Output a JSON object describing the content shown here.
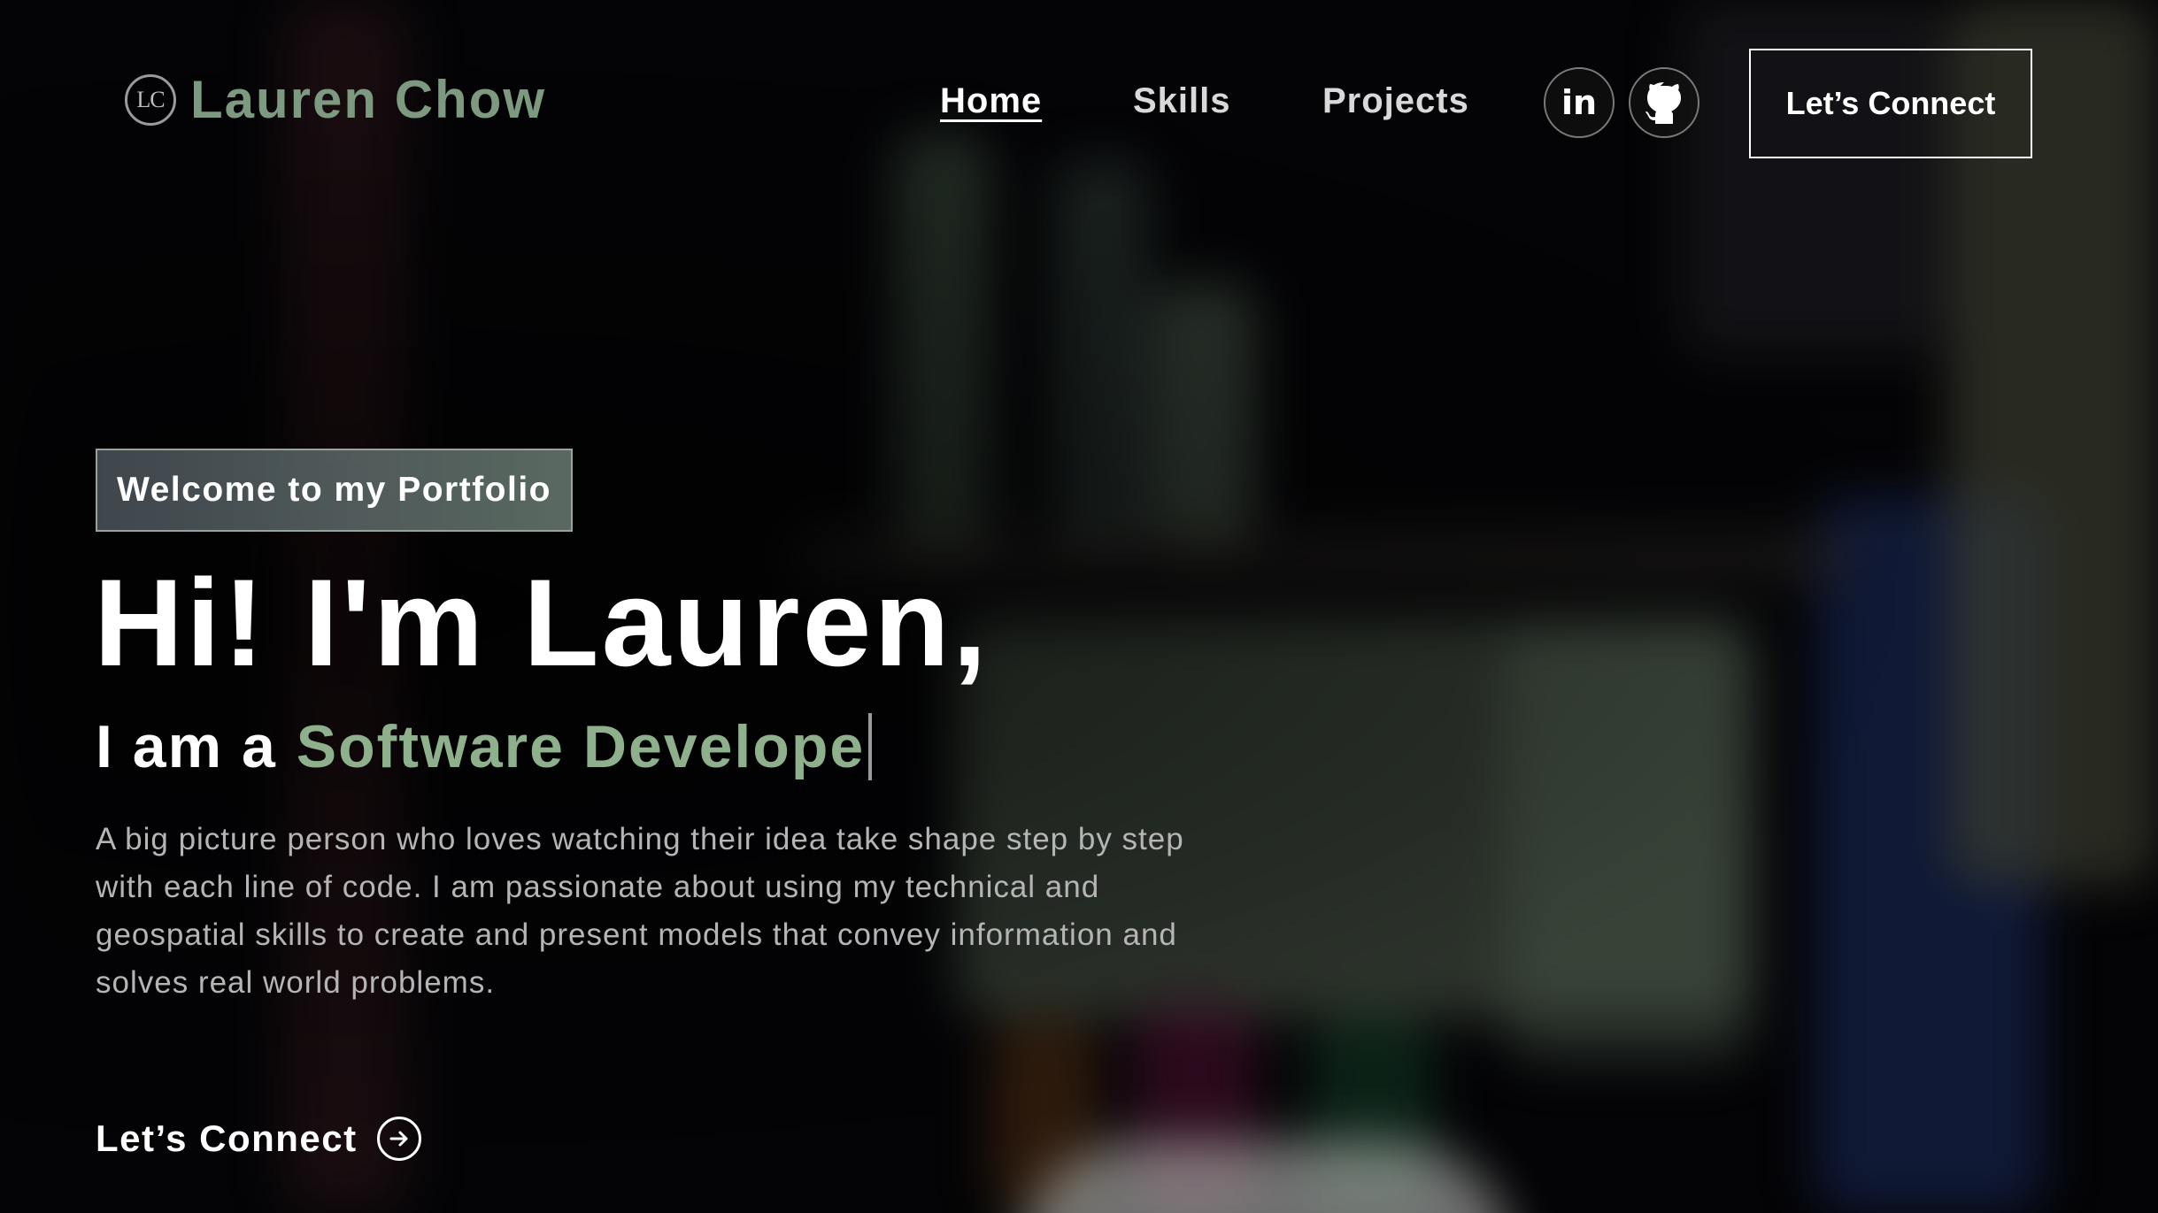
{
  "brand": {
    "monogram": "LC",
    "name": "Lauren Chow"
  },
  "nav": {
    "links": [
      {
        "label": "Home",
        "active": true
      },
      {
        "label": "Skills",
        "active": false
      },
      {
        "label": "Projects",
        "active": false
      }
    ],
    "social": [
      {
        "icon": "linkedin-icon",
        "text": "in"
      },
      {
        "icon": "github-icon"
      }
    ],
    "cta_label": "Let’s Connect"
  },
  "hero": {
    "tagline": "Welcome to my Portfolio",
    "headline": "Hi! I'm Lauren,",
    "subhead_prefix": "I am a",
    "role_typed": "Software Develope",
    "bio": "A big picture person who loves watching their idea take shape step by step with each line of code. I am passionate about using my technical and geospatial skills to create and present models that convey information and solves real world problems.",
    "cta_label": "Let’s Connect"
  },
  "colors": {
    "accent_green": "#8fb08d",
    "brand_green": "#7d9a80",
    "text_primary": "#ffffff",
    "text_muted": "#b5b5b5",
    "background": "#040406"
  }
}
